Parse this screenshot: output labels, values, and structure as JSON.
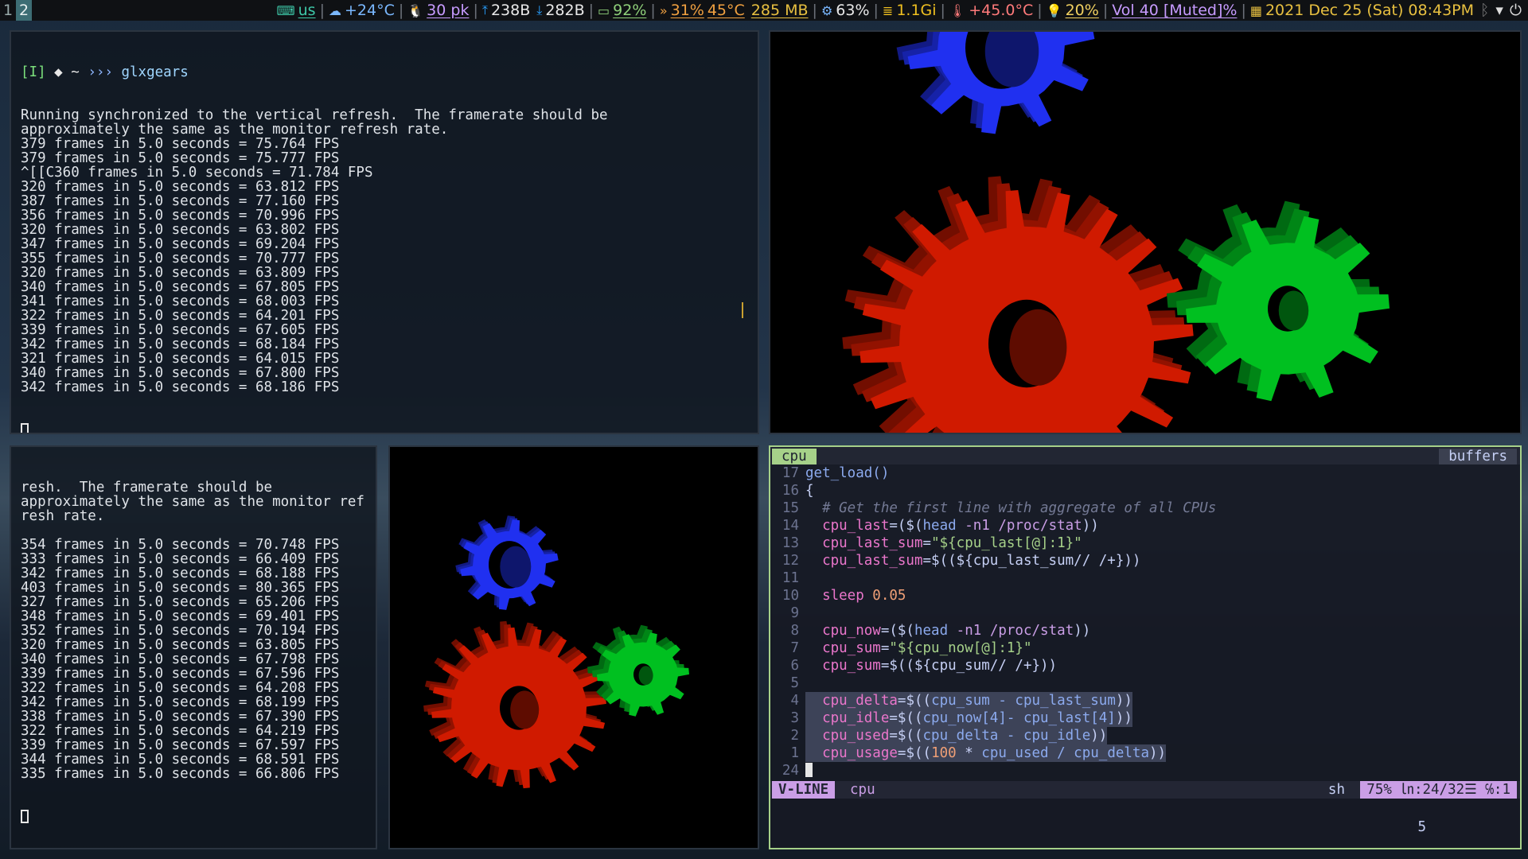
{
  "topbar": {
    "workspaces": [
      "1",
      "2"
    ],
    "keyboard": "us",
    "weather": "+24°C",
    "packages": "30 pk",
    "net_up": "238B",
    "net_down": "282B",
    "battery": "92%",
    "cpu_load": "31%",
    "cpu_temp": "45°C",
    "memory": "285 MB",
    "cpu_usage": "63%",
    "ram": "1.1Gi",
    "temperature": "+45.0°C",
    "brightness": "20%",
    "volume": "Vol 40 [Muted]%",
    "datetime": "2021 Dec 25 (Sat) 08:43PM"
  },
  "term_top": {
    "prompt_tag": "[I]",
    "prompt_dir": "◆ ~",
    "prompt_arrow": "›››",
    "command": "glxgears",
    "lines": [
      "Running synchronized to the vertical refresh.  The framerate should be",
      "approximately the same as the monitor refresh rate.",
      "379 frames in 5.0 seconds = 75.764 FPS",
      "379 frames in 5.0 seconds = 75.777 FPS",
      "^[[C360 frames in 5.0 seconds = 71.784 FPS",
      "320 frames in 5.0 seconds = 63.812 FPS",
      "387 frames in 5.0 seconds = 77.160 FPS",
      "356 frames in 5.0 seconds = 70.996 FPS",
      "320 frames in 5.0 seconds = 63.802 FPS",
      "347 frames in 5.0 seconds = 69.204 FPS",
      "355 frames in 5.0 seconds = 70.777 FPS",
      "320 frames in 5.0 seconds = 63.809 FPS",
      "340 frames in 5.0 seconds = 67.805 FPS",
      "341 frames in 5.0 seconds = 68.003 FPS",
      "322 frames in 5.0 seconds = 64.201 FPS",
      "339 frames in 5.0 seconds = 67.605 FPS",
      "342 frames in 5.0 seconds = 68.184 FPS",
      "321 frames in 5.0 seconds = 64.015 FPS",
      "340 frames in 5.0 seconds = 67.800 FPS",
      "342 frames in 5.0 seconds = 68.186 FPS"
    ]
  },
  "term_bottom": {
    "lines": [
      "resh.  The framerate should be",
      "approximately the same as the monitor ref",
      "resh rate.",
      "",
      "354 frames in 5.0 seconds = 70.748 FPS",
      "333 frames in 5.0 seconds = 66.409 FPS",
      "342 frames in 5.0 seconds = 68.188 FPS",
      "403 frames in 5.0 seconds = 80.365 FPS",
      "327 frames in 5.0 seconds = 65.206 FPS",
      "348 frames in 5.0 seconds = 69.401 FPS",
      "352 frames in 5.0 seconds = 70.194 FPS",
      "320 frames in 5.0 seconds = 63.805 FPS",
      "340 frames in 5.0 seconds = 67.798 FPS",
      "339 frames in 5.0 seconds = 67.596 FPS",
      "322 frames in 5.0 seconds = 64.208 FPS",
      "342 frames in 5.0 seconds = 68.199 FPS",
      "338 frames in 5.0 seconds = 67.390 FPS",
      "322 frames in 5.0 seconds = 64.219 FPS",
      "339 frames in 5.0 seconds = 67.597 FPS",
      "344 frames in 5.0 seconds = 68.591 FPS",
      "335 frames in 5.0 seconds = 66.806 FPS"
    ]
  },
  "editor": {
    "tab": "cpu",
    "buffers_label": "buffers",
    "lines": [
      {
        "n": "17",
        "code": [
          [
            "get_load()",
            "fn"
          ]
        ]
      },
      {
        "n": "16",
        "code": [
          [
            "{",
            "pun"
          ]
        ]
      },
      {
        "n": "15",
        "code": [
          [
            "  # Get the first line with aggregate of all CPUs",
            "cmt"
          ]
        ]
      },
      {
        "n": "14",
        "code": [
          [
            "  cpu_last",
            "var"
          ],
          [
            "=($(",
            "pun"
          ],
          [
            "head",
            "cmd"
          ],
          [
            " -n1 /proc/stat",
            "fl"
          ],
          [
            "))",
            "pun"
          ]
        ]
      },
      {
        "n": "13",
        "code": [
          [
            "  cpu_last_sum",
            "var"
          ],
          [
            "=",
            "pun"
          ],
          [
            "\"${cpu_last[@]:1}\"",
            "str"
          ]
        ]
      },
      {
        "n": "12",
        "code": [
          [
            "  cpu_last_sum",
            "var"
          ],
          [
            "=$((${cpu_last_sum// /+}))",
            "pun"
          ]
        ]
      },
      {
        "n": "11",
        "code": [
          [
            "",
            "pun"
          ]
        ]
      },
      {
        "n": "10",
        "code": [
          [
            "  sleep",
            "var"
          ],
          [
            " 0.05",
            "num"
          ]
        ]
      },
      {
        "n": "9",
        "code": [
          [
            "",
            "pun"
          ]
        ]
      },
      {
        "n": "8",
        "code": [
          [
            "  cpu_now",
            "var"
          ],
          [
            "=($(",
            "pun"
          ],
          [
            "head",
            "cmd"
          ],
          [
            " -n1 /proc/stat",
            "fl"
          ],
          [
            "))",
            "pun"
          ]
        ]
      },
      {
        "n": "7",
        "code": [
          [
            "  cpu_sum",
            "var"
          ],
          [
            "=",
            "pun"
          ],
          [
            "\"${cpu_now[@]:1}\"",
            "str"
          ]
        ]
      },
      {
        "n": "6",
        "code": [
          [
            "  cpu_sum",
            "var"
          ],
          [
            "=$((${cpu_sum// /+}))",
            "pun"
          ]
        ]
      },
      {
        "n": "5",
        "code": [
          [
            "",
            "pun"
          ]
        ]
      },
      {
        "n": "4",
        "code": [
          [
            "  cpu_delta",
            "var"
          ],
          [
            "=$((",
            "pun"
          ],
          [
            "cpu_sum - cpu_last_sum",
            "fn"
          ],
          [
            "))",
            "pun"
          ]
        ],
        "sel": true
      },
      {
        "n": "3",
        "code": [
          [
            "  cpu_idle",
            "var"
          ],
          [
            "=$((",
            "pun"
          ],
          [
            "cpu_now[4]- cpu_last[4]",
            "fn"
          ],
          [
            "))",
            "pun"
          ]
        ],
        "sel": true
      },
      {
        "n": "2",
        "code": [
          [
            "  cpu_used",
            "var"
          ],
          [
            "=$((",
            "pun"
          ],
          [
            "cpu_delta - cpu_idle",
            "fn"
          ],
          [
            "))",
            "pun"
          ]
        ],
        "sel": true
      },
      {
        "n": "1",
        "code": [
          [
            "  cpu_usage",
            "var"
          ],
          [
            "=$((",
            "pun"
          ],
          [
            "100",
            "num"
          ],
          [
            " * ",
            "pun"
          ],
          [
            "cpu_used / cpu_delta",
            "fn"
          ],
          [
            "))",
            "pun"
          ]
        ],
        "sel": true
      },
      {
        "n": "24",
        "code": [
          [
            "",
            "pun"
          ]
        ],
        "cursor": true
      }
    ],
    "mode": "V-LINE",
    "filename": "cpu",
    "filetype": "sh",
    "position": "75% ㏑:24/32☰ ℅:1",
    "selection_count": "5"
  },
  "colors": {
    "gear_red": "#d01a00",
    "gear_green": "#00c020",
    "gear_blue": "#2030f0",
    "editor_border": "#a6d189",
    "mode_bg": "#ca9ee6"
  }
}
